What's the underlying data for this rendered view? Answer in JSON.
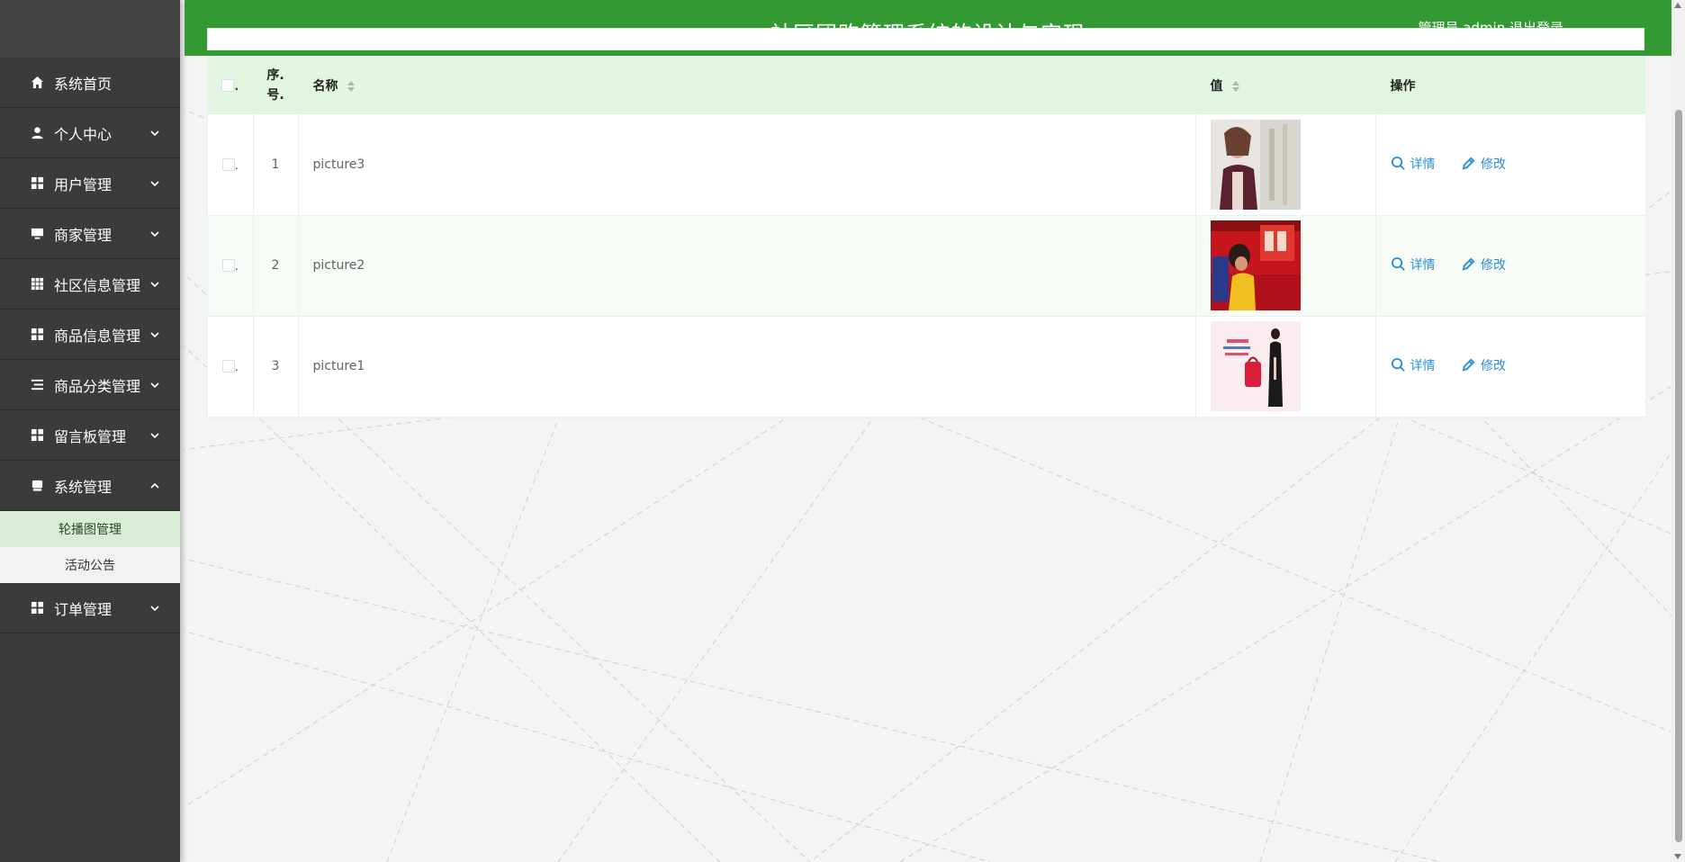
{
  "header": {
    "title": "社区团购管理系统的设计与实现",
    "user_info": "管理员 admin 退出登录"
  },
  "sidebar": {
    "items": [
      {
        "label": "系统首页",
        "icon": "home-icon"
      },
      {
        "label": "个人中心",
        "icon": "user-icon"
      },
      {
        "label": "用户管理",
        "icon": "grid-icon"
      },
      {
        "label": "商家管理",
        "icon": "monitor-icon"
      },
      {
        "label": "社区信息管理",
        "icon": "apps-icon"
      },
      {
        "label": "商品信息管理",
        "icon": "grid-icon"
      },
      {
        "label": "商品分类管理",
        "icon": "list-icon"
      },
      {
        "label": "留言板管理",
        "icon": "grid-icon"
      },
      {
        "label": "系统管理",
        "icon": "device-icon"
      },
      {
        "label": "订单管理",
        "icon": "grid-icon"
      }
    ],
    "system_submenu": [
      {
        "label": "轮播图管理",
        "active": true
      },
      {
        "label": "活动公告",
        "active": false
      }
    ]
  },
  "table": {
    "headers": {
      "check_suffix": ".",
      "index": "序.号.",
      "index_line1": "序.",
      "index_line2": "号.",
      "name": "名称",
      "value": "值",
      "ops": "操作"
    },
    "rows": [
      {
        "index": "1",
        "name": "picture3",
        "value_image": "woman-portrait-thumb"
      },
      {
        "index": "2",
        "name": "picture2",
        "value_image": "red-sale-banner-thumb"
      },
      {
        "index": "3",
        "name": "picture1",
        "value_image": "red-bag-ad-thumb"
      }
    ],
    "detail_label": "详情",
    "edit_label": "修改"
  },
  "colors": {
    "header_green": "#339933",
    "table_head_bg": "#e2f5e0",
    "sidebar_bg": "#3a3a3a",
    "submenu_active_bg": "#d9ecd5",
    "link_blue": "#2a8fd8"
  }
}
